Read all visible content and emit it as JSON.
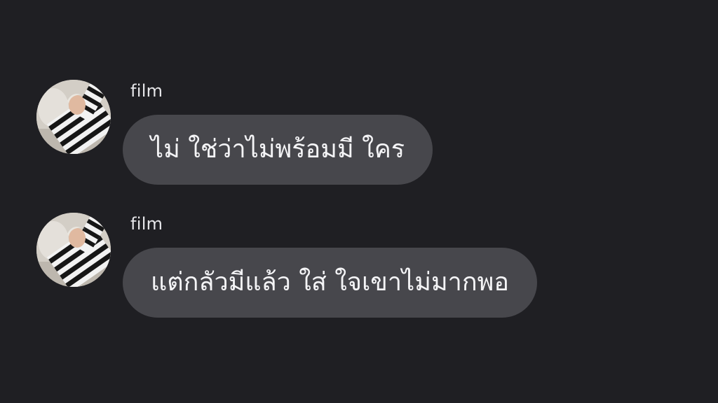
{
  "messages": [
    {
      "sender": "film",
      "text": "ไม่ ใช่ว่าไม่พร้อมมี ใคร",
      "avatar_icon": "profile-photo-striped-shirt"
    },
    {
      "sender": "film",
      "text": "แต่กลัวมีแล้ว ใส่ ใจเขาไม่มากพอ",
      "avatar_icon": "profile-photo-striped-shirt"
    }
  ],
  "colors": {
    "background": "#1f1f23",
    "bubble": "#47474c",
    "text": "#f4f4f6",
    "sender": "#e6e6e9"
  }
}
